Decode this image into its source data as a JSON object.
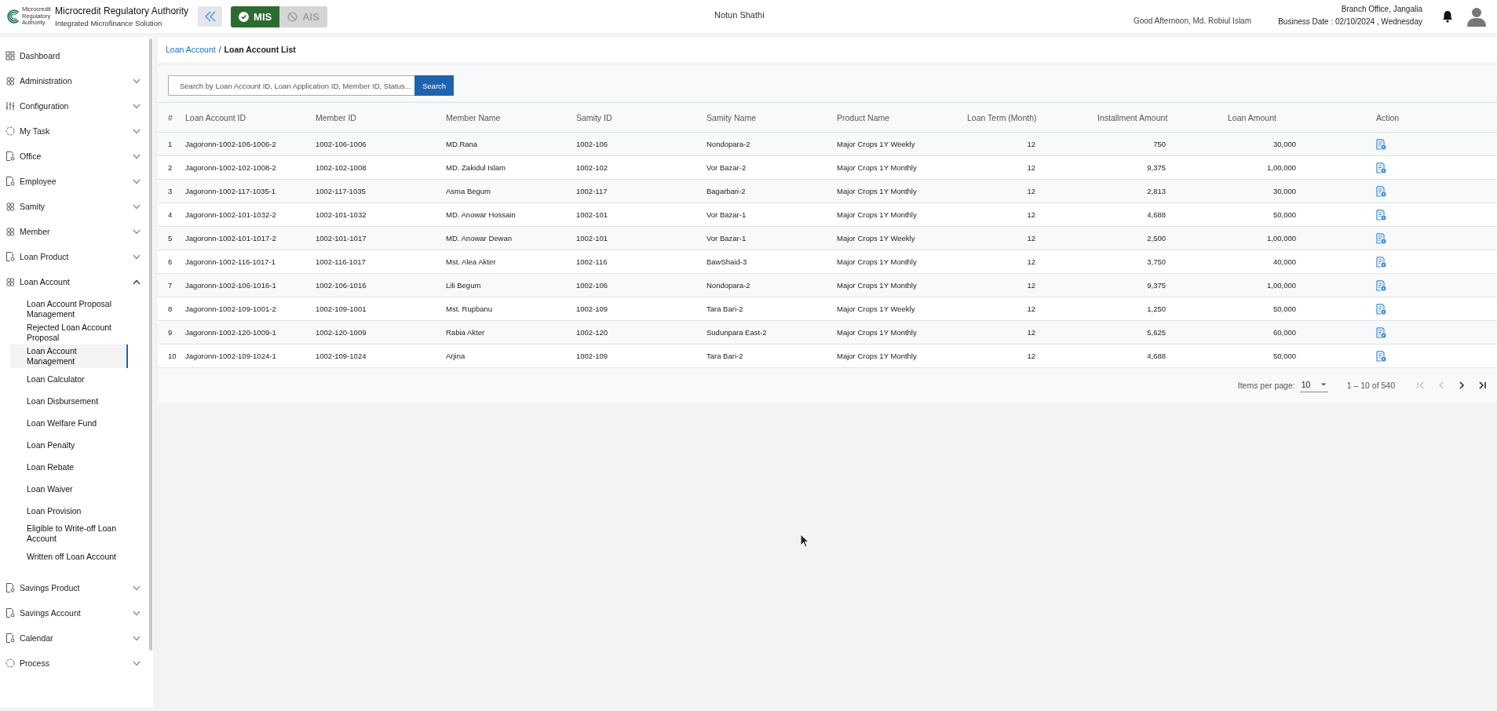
{
  "header": {
    "logo_text": "Microcredit Regulatory Authority",
    "title": "Microcredit Regulatory Authority",
    "subtitle": "Integrated Microfinance Solution",
    "modules": [
      {
        "label": "MIS",
        "selected": true
      },
      {
        "label": "AIS",
        "selected": false
      }
    ],
    "organization": "Notun Shathi",
    "greeting": "Good Afternoon, Md. Robiul Islam",
    "branch": "Branch Office, Jangalia",
    "business_date": "Business Date : 02/10/2024 , Wednesday"
  },
  "sidebar": {
    "items": [
      {
        "label": "Dashboard"
      },
      {
        "label": "Administration",
        "expanded": false
      },
      {
        "label": "Configuration",
        "expanded": false
      },
      {
        "label": "My Task",
        "expanded": false
      },
      {
        "label": "Office",
        "expanded": false
      },
      {
        "label": "Employee",
        "expanded": false
      },
      {
        "label": "Samity",
        "expanded": false
      },
      {
        "label": "Member",
        "expanded": false
      },
      {
        "label": "Loan Product",
        "expanded": false
      },
      {
        "label": "Loan Account",
        "expanded": true,
        "children": [
          {
            "label": "Loan Account Proposal Management",
            "selected": false
          },
          {
            "label": "Rejected Loan Account Proposal",
            "selected": false
          },
          {
            "label": "Loan Account Management",
            "selected": true
          },
          {
            "label": "Loan Calculator",
            "selected": false
          },
          {
            "label": "Loan Disbursement",
            "selected": false
          },
          {
            "label": "Loan Welfare Fund",
            "selected": false
          },
          {
            "label": "Loan Penalty",
            "selected": false
          },
          {
            "label": "Loan Rebate",
            "selected": false
          },
          {
            "label": "Loan Waiver",
            "selected": false
          },
          {
            "label": "Loan Provision",
            "selected": false
          },
          {
            "label": "Eligible to Write-off Loan Account",
            "selected": false
          },
          {
            "label": "Written off Loan Account",
            "selected": false
          }
        ]
      },
      {
        "label": "Savings Product",
        "expanded": false
      },
      {
        "label": "Savings Account",
        "expanded": false
      },
      {
        "label": "Calendar",
        "expanded": false
      },
      {
        "label": "Process",
        "expanded": false
      }
    ]
  },
  "breadcrumb": {
    "separator": "/",
    "items": [
      {
        "label": "Loan Account",
        "kind": "link"
      },
      {
        "label": "Loan Account List",
        "kind": "current"
      }
    ]
  },
  "search": {
    "placeholder": "Search by Loan Account ID, Loan Application ID, Member ID, Status...",
    "button": "Search"
  },
  "table": {
    "columns": [
      "#",
      "Loan Account ID",
      "Member ID",
      "Member Name",
      "Samity ID",
      "Samity Name",
      "Product Name",
      "Loan Term (Month)",
      "Installment Amount",
      "Loan Amount",
      "Action"
    ],
    "rows": [
      [
        "1",
        "Jagoronn-1002-106-1006-2",
        "1002-106-1006",
        "MD.Rana",
        "1002-106",
        "Nondopara-2",
        "Major Crops 1Y Weekly",
        "12",
        "750",
        "30,000"
      ],
      [
        "2",
        "Jagoronn-1002-102-1008-2",
        "1002-102-1008",
        "MD. Zakidul Islam",
        "1002-102",
        "Vor Bazar-2",
        "Major Crops 1Y Monthly",
        "12",
        "9,375",
        "1,00,000"
      ],
      [
        "3",
        "Jagoronn-1002-117-1035-1",
        "1002-117-1035",
        "Asma Begum",
        "1002-117",
        "Bagarbari-2",
        "Major Crops 1Y Monthly",
        "12",
        "2,813",
        "30,000"
      ],
      [
        "4",
        "Jagoronn-1002-101-1032-2",
        "1002-101-1032",
        "MD. Anowar Hossain",
        "1002-101",
        "Vor Bazar-1",
        "Major Crops 1Y Monthly",
        "12",
        "4,688",
        "50,000"
      ],
      [
        "5",
        "Jagoronn-1002-101-1017-2",
        "1002-101-1017",
        "MD. Anowar Dewan",
        "1002-101",
        "Vor Bazar-1",
        "Major Crops 1Y Weekly",
        "12",
        "2,500",
        "1,00,000"
      ],
      [
        "6",
        "Jagoronn-1002-116-1017-1",
        "1002-116-1017",
        "Mst. Alea Akter",
        "1002-116",
        "BawShaid-3",
        "Major Crops 1Y Monthly",
        "12",
        "3,750",
        "40,000"
      ],
      [
        "7",
        "Jagoronn-1002-106-1016-1",
        "1002-106-1016",
        "Lili Begum",
        "1002-106",
        "Nondopara-2",
        "Major Crops 1Y Monthly",
        "12",
        "9,375",
        "1,00,000"
      ],
      [
        "8",
        "Jagoronn-1002-109-1001-2",
        "1002-109-1001",
        "Mst. Rupbanu",
        "1002-109",
        "Tara Bari-2",
        "Major Crops 1Y Weekly",
        "12",
        "1,250",
        "50,000"
      ],
      [
        "9",
        "Jagoronn-1002-120-1009-1",
        "1002-120-1009",
        "Rabia Akter",
        "1002-120",
        "Sudunpara East-2",
        "Major Crops 1Y Monthly",
        "12",
        "5,625",
        "60,000"
      ],
      [
        "10",
        "Jagoronn-1002-109-1024-1",
        "1002-109-1024",
        "Arjina",
        "1002-109",
        "Tara Bari-2",
        "Major Crops 1Y Monthly",
        "12",
        "4,688",
        "50,000"
      ]
    ]
  },
  "pagination": {
    "items_per_page_label": "Items per page:",
    "items_per_page": "10",
    "range": "1 – 10 of 540",
    "buttons": [
      {
        "kind": "first",
        "disabled": true
      },
      {
        "kind": "prev",
        "disabled": true
      },
      {
        "kind": "next",
        "disabled": false
      },
      {
        "kind": "last",
        "disabled": false
      }
    ]
  }
}
